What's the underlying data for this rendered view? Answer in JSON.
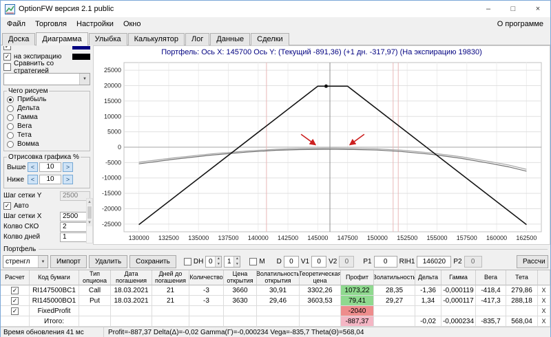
{
  "window": {
    "title": "OptionFW версия 2.1 public"
  },
  "icons": {
    "check": "✓",
    "dropdown": "▼",
    "minimize": "–",
    "maximize": "□",
    "close": "×",
    "spin_left": "<",
    "spin_right": ">",
    "spin_up": "▲",
    "spin_down": "▼"
  },
  "menu": {
    "items": [
      "Файл",
      "Торговля",
      "Настройки",
      "Окно"
    ],
    "about": "О программе"
  },
  "tabs": {
    "items": [
      "Доска",
      "Диаграмма",
      "Улыбка",
      "Калькулятор",
      "Лог",
      "Данные",
      "Сделки"
    ],
    "active": "Диаграмма"
  },
  "sidebar": {
    "expiry_label": "на экспирацию",
    "expiry_color": "#000000",
    "current_color": "#000080",
    "compare_label": "Сравнить со стратегией",
    "draw_title": "Чего рисуем",
    "draw_options": [
      "Прибыль",
      "Дельта",
      "Гамма",
      "Вега",
      "Тета",
      "Вомма"
    ],
    "draw_selected": "Прибыль",
    "render_title": "Отрисовка графика %",
    "above_label": "Выше",
    "above_value": "10",
    "below_label": "Ниже",
    "below_value": "10",
    "grid_y_label": "Шаг сетки Y",
    "grid_y_value": "2500",
    "auto_label": "Авто",
    "grid_x_label": "Шаг сетки X",
    "grid_x_value": "2500",
    "sko_label": "Колво СКО",
    "sko_value": "2",
    "days_label": "Колво дней",
    "days_value": "1"
  },
  "chart_data": {
    "type": "line",
    "title": "Портфель:  Ось X: 145700  Ось Y:   (Текущий -891,36)   (+1 дн. -317,97)   (На экспирацию 19830)",
    "xlim": [
      128750,
      163750
    ],
    "ylim": [
      -27500,
      27500
    ],
    "x_ticks": [
      130000,
      132500,
      135000,
      137500,
      140000,
      142500,
      145000,
      147500,
      150000,
      152500,
      155000,
      157500,
      160000,
      162500
    ],
    "y_ticks": [
      25000,
      20000,
      15000,
      10000,
      5000,
      0,
      -5000,
      -10000,
      -15000,
      -20000,
      -25000
    ],
    "grid": true,
    "series": [
      {
        "id": "plus1day",
        "name": "+1 дн.",
        "color": "#a4a4a4",
        "width": 1.2,
        "points": [
          [
            130000,
            -4900
          ],
          [
            133000,
            -3450
          ],
          [
            136000,
            -2200
          ],
          [
            139000,
            -1250
          ],
          [
            141500,
            -680
          ],
          [
            143500,
            -430
          ],
          [
            145500,
            -330
          ],
          [
            146500,
            -340
          ],
          [
            148000,
            -380
          ],
          [
            150000,
            -560
          ],
          [
            152000,
            -980
          ],
          [
            154500,
            -1850
          ],
          [
            157000,
            -3100
          ],
          [
            159500,
            -4750
          ],
          [
            161000,
            -5800
          ],
          [
            162500,
            -7200
          ]
        ]
      },
      {
        "id": "current",
        "name": "Текущий",
        "color": "#6e6e6e",
        "width": 1.2,
        "points": [
          [
            130000,
            -5400
          ],
          [
            133000,
            -3900
          ],
          [
            136000,
            -2600
          ],
          [
            139000,
            -1600
          ],
          [
            141500,
            -1000
          ],
          [
            143500,
            -780
          ],
          [
            145500,
            -700
          ],
          [
            146500,
            -720
          ],
          [
            148000,
            -760
          ],
          [
            150000,
            -950
          ],
          [
            152000,
            -1400
          ],
          [
            154500,
            -2300
          ],
          [
            157000,
            -3600
          ],
          [
            159500,
            -5300
          ],
          [
            161000,
            -6400
          ],
          [
            162500,
            -7800
          ]
        ]
      },
      {
        "id": "expiration",
        "name": "На экспирацию",
        "color": "#141414",
        "width": 1.6,
        "points": [
          [
            130000,
            -25170
          ],
          [
            145000,
            19830
          ],
          [
            147500,
            19830
          ],
          [
            162500,
            -25170
          ]
        ]
      }
    ],
    "vlines": [
      {
        "id": "sigma-left",
        "x": 140700,
        "color": "#eab8b8"
      },
      {
        "id": "sigma-right",
        "x": 151320,
        "color": "#eab8b8"
      },
      {
        "id": "sigma-right-2",
        "x": 151750,
        "color": "#eab8b8"
      },
      {
        "id": "current-price",
        "x": 146020,
        "color": "#8c8c8c"
      }
    ],
    "marker": {
      "x": 145700,
      "y": 19830
    },
    "arrows": [
      {
        "id": "left-strike-arrow",
        "from": [
          143600,
          4200
        ],
        "to": [
          144800,
          800
        ],
        "color": "#cc2020"
      },
      {
        "id": "right-strike-arrow",
        "from": [
          148900,
          4200
        ],
        "to": [
          147700,
          800
        ],
        "color": "#cc2020"
      }
    ]
  },
  "portfolio": {
    "group_label": "Портфель",
    "strategy_value": "стренгл",
    "import_label": "Импорт",
    "delete_label": "Удалить",
    "save_label": "Сохранить",
    "dh_label": "DH",
    "dh_value1": "0",
    "dh_value2": "1",
    "m_label": "M",
    "d_label": "D",
    "d_value": "0",
    "v1_label": "V1",
    "v1_value": "0",
    "v2_label": "V2",
    "v2_value": "0",
    "p1_label": "P1",
    "p1_value": "0",
    "ticker_label": "RIH1",
    "ticker_value": "146020",
    "p2_label": "P2",
    "p2_value": "0",
    "calc_label": "Рассчи"
  },
  "table": {
    "close_label": "X",
    "headers": [
      "Расчет",
      "Код бумаги",
      "Тип опциона",
      "Дата погашения",
      "Дней до погашения",
      "Количество",
      "Цена открытия",
      "Волатильность открытия",
      "Теоретическая цена",
      "Профит",
      "Волатильность",
      "Дельта",
      "Гамма",
      "Вега",
      "Тета",
      ""
    ],
    "colors": {
      "profit_green": "#8fd98f",
      "loss_red": "#ee8c8c",
      "total_pink": "#f4b6c4"
    },
    "rows": [
      {
        "checkbox": "checked",
        "profit_bg": "#8fd98f",
        "cells": [
          "RI147500BC1",
          "Call",
          "18.03.2021",
          "21",
          "-3",
          "3660",
          "30,91",
          "3302,26",
          "1073,22",
          "28,35",
          "-1,36",
          "-0,000119",
          "-418,4",
          "279,86"
        ]
      },
      {
        "checkbox": "checked",
        "profit_bg": "#8fd98f",
        "cells": [
          "RI145000BO1",
          "Put",
          "18.03.2021",
          "21",
          "-3",
          "3630",
          "29,46",
          "3603,53",
          "79,41",
          "29,27",
          "1,34",
          "-0,000117",
          "-417,3",
          "288,18"
        ]
      },
      {
        "checkbox": "checked",
        "profit_bg": "#ee8c8c",
        "cells": [
          "FixedProfit",
          "",
          "",
          "",
          "",
          "",
          "",
          "",
          "-2040",
          "",
          "",
          "",
          "",
          ""
        ]
      },
      {
        "checkbox": "none",
        "profit_bg": "#f4b6c4",
        "cells": [
          "Итого:",
          "",
          "",
          "",
          "",
          "",
          "",
          "",
          "-887,37",
          "",
          "-0,02",
          "-0,000234",
          "-835,7",
          "568,04"
        ]
      }
    ]
  },
  "statusbar": {
    "update_time": "Время обновления 41 мс",
    "summary": "Profit=-887,37 Delta(Δ)=-0,02 Gamma(Γ)=-0,000234 Vega=-835,7 Theta(Θ)=568,04"
  }
}
